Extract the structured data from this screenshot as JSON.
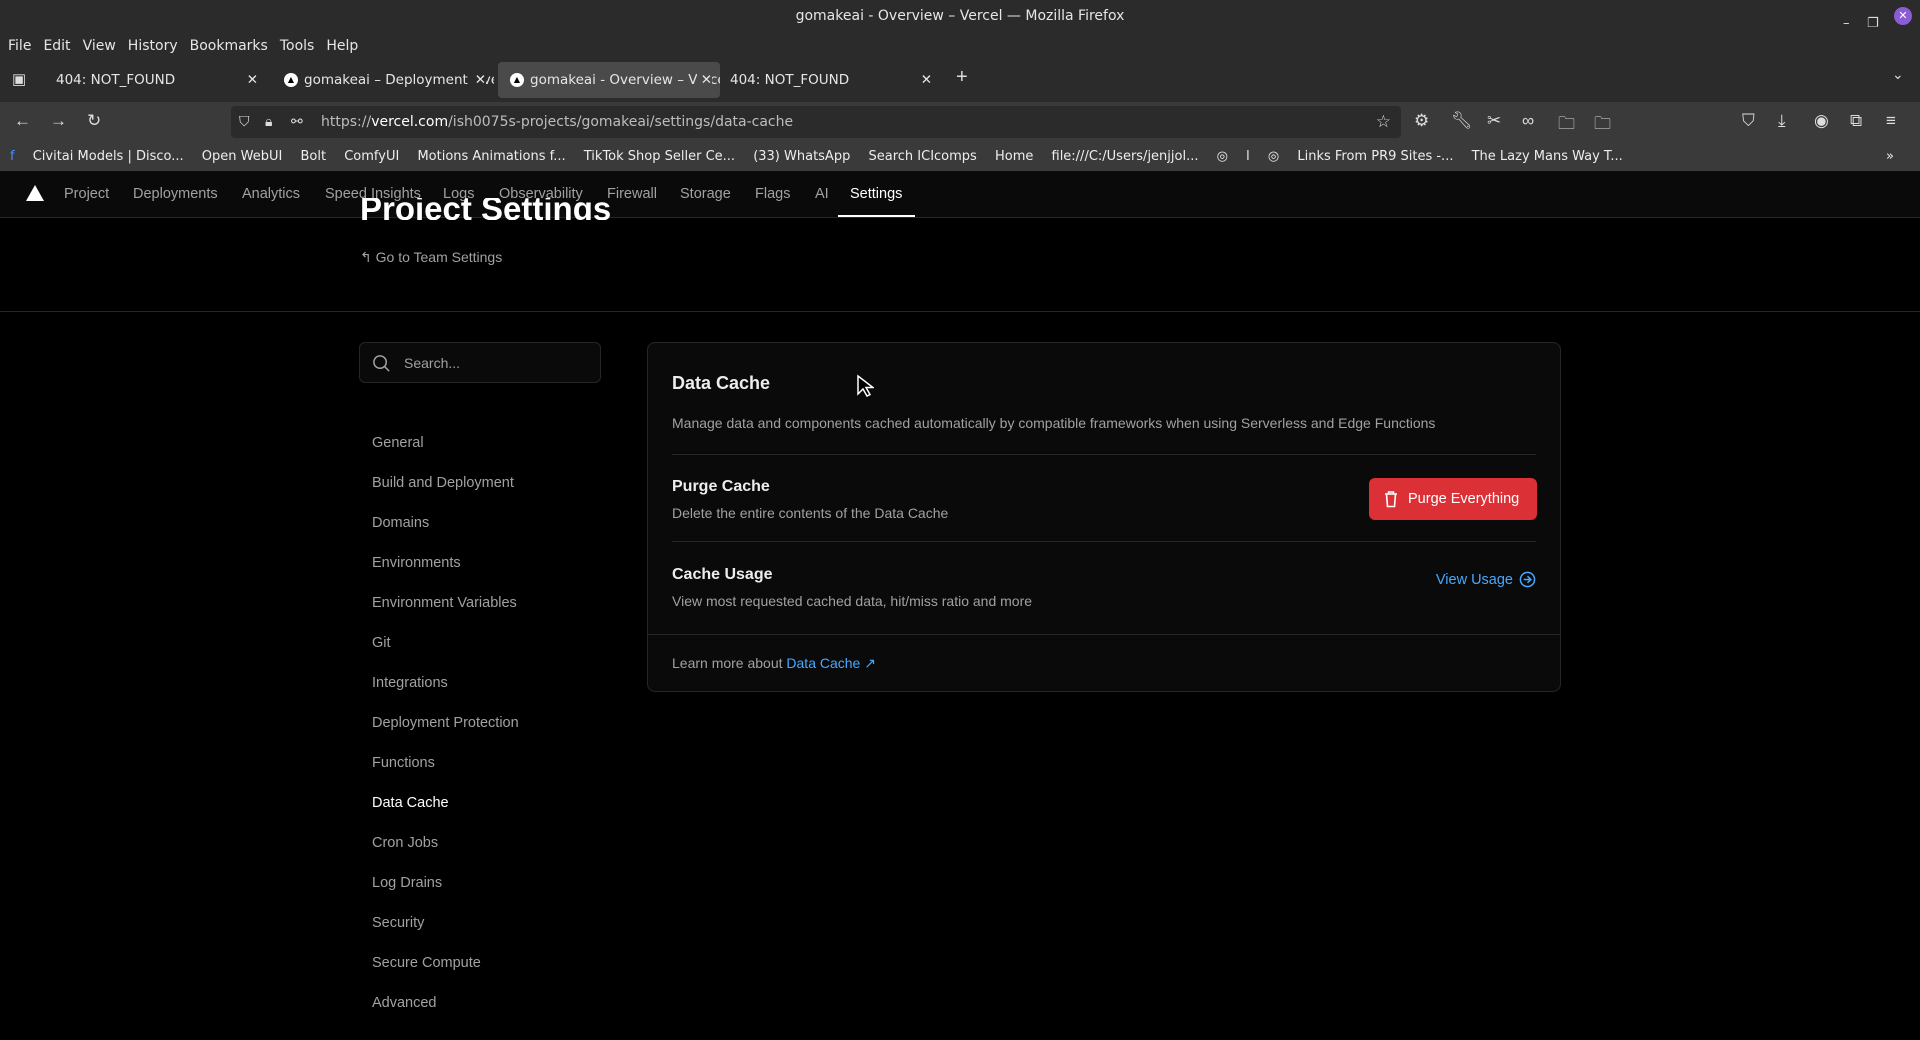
{
  "window": {
    "title": "gomakeai - Overview – Vercel — Mozilla Firefox"
  },
  "menu": [
    "File",
    "Edit",
    "View",
    "History",
    "Bookmarks",
    "Tools",
    "Help"
  ],
  "tabs": [
    {
      "label": "404: NOT_FOUND"
    },
    {
      "label": "gomakeai – Deployment Overview"
    },
    {
      "label": "gomakeai - Overview – Vercel"
    },
    {
      "label": "404: NOT_FOUND"
    }
  ],
  "url": {
    "domain": "vercel.com",
    "path": "/ish0075s-projects/gomakeai/settings/data-cache",
    "prefix": "https://"
  },
  "bookmarks": [
    "Civitai Models | Disco...",
    "Open WebUI",
    "Bolt",
    "ComfyUI",
    "Motions Animations f...",
    "TikTok Shop Seller Ce...",
    "(33) WhatsApp",
    "Search ICIcomps",
    "Home",
    "file:///C:/Users/jenjjol...",
    "l",
    "Links From PR9 Sites -...",
    "The Lazy Mans Way T..."
  ],
  "vercel_nav": [
    "Project",
    "Deployments",
    "Analytics",
    "Speed Insights",
    "Logs",
    "Observability",
    "Firewall",
    "Storage",
    "Flags",
    "AI",
    "Settings"
  ],
  "page": {
    "title": "Project Settings",
    "back_link": "Go to Team Settings",
    "search_placeholder": "Search..."
  },
  "sidebar": [
    "General",
    "Build and Deployment",
    "Domains",
    "Environments",
    "Environment Variables",
    "Git",
    "Integrations",
    "Deployment Protection",
    "Functions",
    "Data Cache",
    "Cron Jobs",
    "Log Drains",
    "Security",
    "Secure Compute",
    "Advanced"
  ],
  "card": {
    "title": "Data Cache",
    "description": "Manage data and components cached automatically by compatible frameworks when using Serverless and Edge Functions",
    "purge_title": "Purge Cache",
    "purge_desc": "Delete the entire contents of the Data Cache",
    "purge_button": "Purge Everything",
    "usage_title": "Cache Usage",
    "usage_desc": "View most requested cached data, hit/miss ratio and more",
    "usage_link": "View Usage",
    "footer_text": "Learn more about ",
    "footer_link": "Data Cache"
  },
  "colors": {
    "danger": "#da3036",
    "link": "#47a8ff"
  }
}
